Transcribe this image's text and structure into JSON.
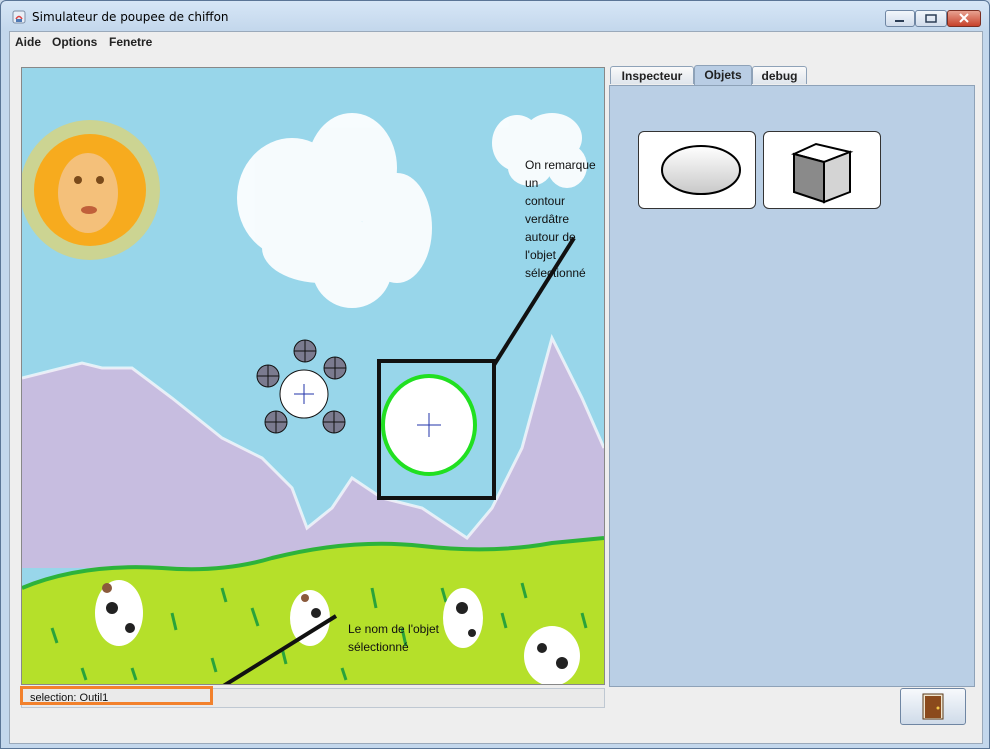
{
  "window": {
    "title": "Simulateur de poupee de chiffon"
  },
  "menubar": {
    "items": [
      "Aide",
      "Options",
      "Fenetre"
    ]
  },
  "tabs": [
    {
      "label": "Inspecteur",
      "active": false
    },
    {
      "label": "Objets",
      "active": true
    },
    {
      "label": "debug",
      "active": false
    }
  ],
  "objects_panel": {
    "tools": [
      "ellipse-tool",
      "cube-tool"
    ]
  },
  "statusbar": {
    "selection": "selection: Outil1"
  },
  "annotations": {
    "outline_note": [
      "On remarque un",
      "contour verdâtre",
      "autour de l'objet",
      "sélectionné"
    ],
    "name_note": [
      "Le nom de l'objet",
      "sélectionné"
    ]
  },
  "colors": {
    "highlight_outline": "#21e021",
    "annotation_box_orange": "#f2812c",
    "sky": "#98d6ea",
    "mountains": "#c7bde0",
    "grass": "#b5e02a"
  }
}
